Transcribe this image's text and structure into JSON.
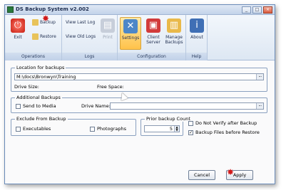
{
  "window": {
    "title": "DS Backup System v2.002",
    "min": "_",
    "max": "□",
    "close": "×"
  },
  "ribbon": {
    "exit": "Exit",
    "backup": "Backup",
    "restore": "Restore",
    "operations_caption": "Operations",
    "view_last_log": "View Last Log",
    "view_old_logs": "View Old Logs",
    "print": "Print",
    "logs_caption": "Logs",
    "settings": "Settings",
    "client_server": "Client Server",
    "manage_backups": "Manage Backups",
    "configuration_caption": "Configuration",
    "about": "About",
    "help_caption": "Help"
  },
  "location": {
    "label": "Location for backups",
    "path": "M:\\docs\\Bronwyn\\Training",
    "drive_size": "Drive Size:",
    "free_space": "Free Space:",
    "browse": "..."
  },
  "additional": {
    "label": "Additional Backups",
    "send_to_media": "Send to Media",
    "drive_name": "Drive Name:",
    "browse": "..."
  },
  "exclude": {
    "label": "Exclude From Backup",
    "executables": "Executables",
    "photographs": "Photographs"
  },
  "prior": {
    "label": "Prior backup Count",
    "value": "5"
  },
  "options": {
    "no_verify": "Do Not Verify after Backup",
    "no_verify_checked": false,
    "backup_before_restore": "Backup Files before Restore",
    "backup_before_restore_checked": true
  },
  "buttons": {
    "cancel": "Cancel",
    "apply": "Apply"
  }
}
